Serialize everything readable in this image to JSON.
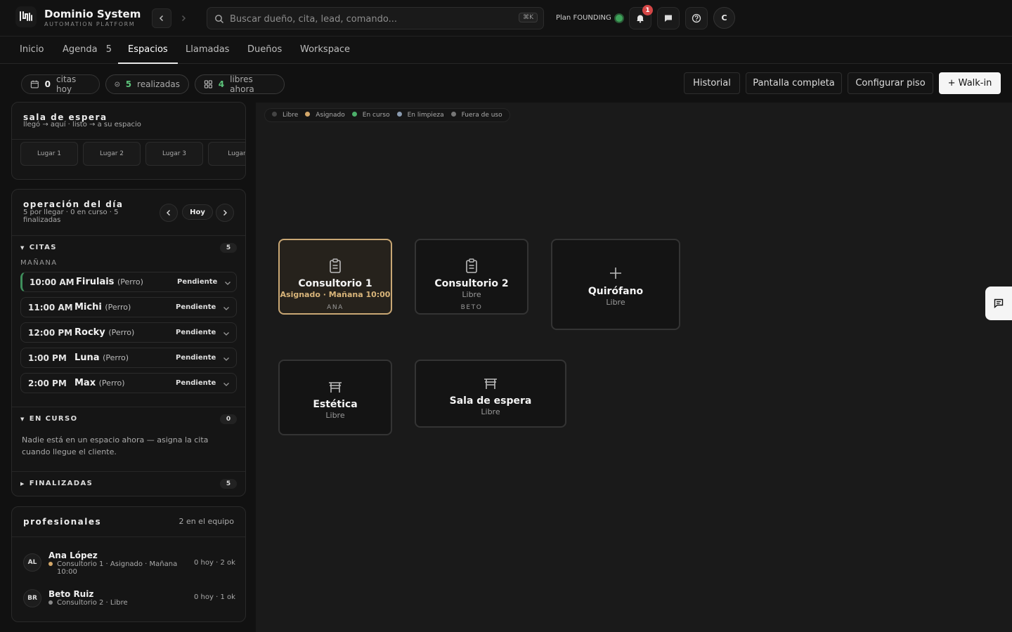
{
  "app": {
    "name": "Dominio System",
    "subtitle": "AUTOMATION PLATFORM",
    "search_placeholder": "Buscar dueño, cita, lead, comando...",
    "search_shortcut": "⌘K",
    "plan_label": "Plan FOUNDING",
    "notifications_count": "1",
    "user_initial": "C"
  },
  "tabs": [
    {
      "label": "Inicio"
    },
    {
      "label": "Agenda",
      "badge": "5"
    },
    {
      "label": "Espacios",
      "active": true
    },
    {
      "label": "Llamadas"
    },
    {
      "label": "Dueños"
    },
    {
      "label": "Workspace"
    }
  ],
  "stats": {
    "citas_hoy_value": "0",
    "citas_hoy_label": "citas hoy",
    "realizadas_value": "5",
    "realizadas_label": "realizadas",
    "libres_value": "4",
    "libres_label": "libres ahora"
  },
  "actions": {
    "historial": "Historial",
    "pantalla": "Pantalla completa",
    "configurar": "Configurar piso",
    "walkin": "+ Walk-in"
  },
  "waiting": {
    "title": "sala de espera",
    "subtitle": "llegó → aquí · listo → a su espacio",
    "slots": [
      "Lugar 1",
      "Lugar 2",
      "Lugar 3",
      "Lugar"
    ]
  },
  "operation": {
    "title": "operación del día",
    "summary_line1": "5 por llegar · 0 en curso · 5",
    "summary_line2": "finalizadas",
    "today_label": "Hoy",
    "citas_label": "CITAS",
    "citas_count": "5",
    "period_label": "MAÑANA",
    "appointments": [
      {
        "time": "10:00 AM",
        "name": "Firulais",
        "species": "(Perro)",
        "status": "Pendiente"
      },
      {
        "time": "11:00 AM",
        "name": "Michi",
        "species": "(Perro)",
        "status": "Pendiente"
      },
      {
        "time": "12:00 PM",
        "name": "Rocky",
        "species": "(Perro)",
        "status": "Pendiente"
      },
      {
        "time": "1:00 PM",
        "name": "Luna",
        "species": "(Perro)",
        "status": "Pendiente"
      },
      {
        "time": "2:00 PM",
        "name": "Max",
        "species": "(Perro)",
        "status": "Pendiente"
      }
    ],
    "en_curso_label": "EN CURSO",
    "en_curso_count": "0",
    "en_curso_empty_line1": "Nadie está en un espacio ahora — asigna la cita",
    "en_curso_empty_line2": "cuando llegue el cliente.",
    "finalizadas_label": "FINALIZADAS",
    "finalizadas_count": "5"
  },
  "professionals": {
    "title": "profesionales",
    "team_count": "2 en el equipo",
    "list": [
      {
        "initials": "AL",
        "name": "Ana López",
        "detail_line1": "Consultorio 1 · Asignado · Mañana",
        "detail_line2": "10:00",
        "stats": "0 hoy · 2 ok",
        "dot_color": "#d4a86a"
      },
      {
        "initials": "BR",
        "name": "Beto Ruiz",
        "detail_line1": "Consultorio 2 · Libre",
        "detail_line2": "",
        "stats": "0 hoy · 1 ok",
        "dot_color": "#8a8a8a"
      }
    ]
  },
  "legend": [
    {
      "label": "Libre",
      "color": "#444444"
    },
    {
      "label": "Asignado",
      "color": "#d4a86a"
    },
    {
      "label": "En curso",
      "color": "#4caf6a"
    },
    {
      "label": "En limpieza",
      "color": "#8a9bb0"
    },
    {
      "label": "Fuera de uso",
      "color": "#777777"
    }
  ],
  "rooms": [
    {
      "name": "Consultorio 1",
      "status": "Asignado · Mañana 10:00",
      "staff": "ANA",
      "icon": "clipboard-icon"
    },
    {
      "name": "Consultorio 2",
      "status": "Libre",
      "staff": "BETO",
      "icon": "clipboard-icon"
    },
    {
      "name": "Quirófano",
      "status": "Libre",
      "staff": "",
      "icon": "plus-icon"
    },
    {
      "name": "Estética",
      "status": "Libre",
      "staff": "",
      "icon": "bench-icon"
    },
    {
      "name": "Sala de espera",
      "status": "Libre",
      "staff": "",
      "icon": "bench-icon"
    }
  ],
  "colors": {
    "accent_gold": "#d4a86a",
    "accent_green": "#4caf6a",
    "badge_red": "#d44646"
  }
}
